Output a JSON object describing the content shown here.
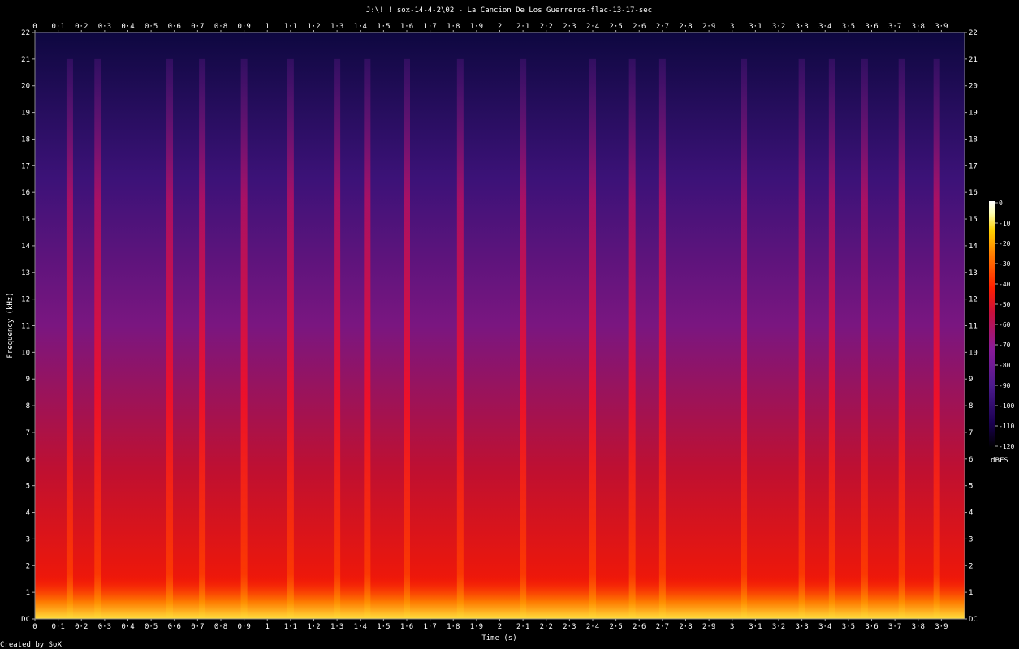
{
  "chart_data": {
    "type": "heatmap",
    "title": "J:\\! ! sox-14-4-2\\02 - La Cancion De Los Guerreros-flac-13-17-sec",
    "xlabel": "Time (s)",
    "ylabel": "Frequency (kHz)",
    "xlim": [
      0,
      4.0
    ],
    "ylim": [
      0,
      22
    ],
    "x_ticks": [
      "0",
      "0·1",
      "0·2",
      "0·3",
      "0·4",
      "0·5",
      "0·6",
      "0·7",
      "0·8",
      "0·9",
      "1",
      "1·1",
      "1·2",
      "1·3",
      "1·4",
      "1·5",
      "1·6",
      "1·7",
      "1·8",
      "1·9",
      "2",
      "2·1",
      "2·2",
      "2·3",
      "2·4",
      "2·5",
      "2·6",
      "2·7",
      "2·8",
      "2·9",
      "3",
      "3·1",
      "3·2",
      "3·3",
      "3·4",
      "3·5",
      "3·6",
      "3·7",
      "3·8",
      "3·9"
    ],
    "y_ticks": [
      "DC",
      "1",
      "2",
      "3",
      "4",
      "5",
      "6",
      "7",
      "8",
      "9",
      "10",
      "11",
      "12",
      "13",
      "14",
      "15",
      "16",
      "17",
      "18",
      "19",
      "20",
      "21",
      "22"
    ],
    "colorbar": {
      "label": "dBFS",
      "range": [
        -120,
        0
      ],
      "ticks": [
        "0",
        "-10",
        "-20",
        "-30",
        "-40",
        "-50",
        "-60",
        "-70",
        "-80",
        "-90",
        "-100",
        "-110",
        "-120"
      ],
      "colors": [
        "#000000",
        "#1a0050",
        "#4b1a8c",
        "#8a1a9a",
        "#c8103a",
        "#ff2000",
        "#ff7a00",
        "#ffd000",
        "#ffffb0",
        "#ffffff"
      ]
    },
    "onsets_s": [
      0.15,
      0.27,
      0.58,
      0.72,
      0.9,
      1.1,
      1.3,
      1.43,
      1.6,
      1.83,
      2.1,
      2.4,
      2.57,
      2.7,
      3.05,
      3.3,
      3.43,
      3.57,
      3.73,
      3.88
    ],
    "grid": false
  },
  "footer": "Created by SoX"
}
